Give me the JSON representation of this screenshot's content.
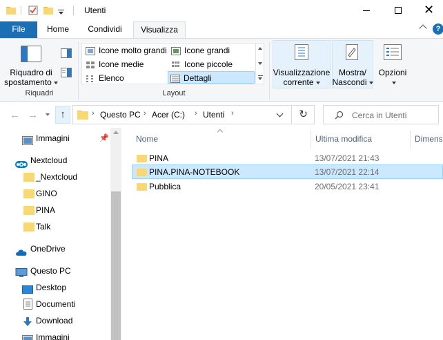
{
  "window": {
    "title": "Utenti",
    "minimize_symbol": "",
    "maximize_symbol": "",
    "close_symbol": "✕"
  },
  "ribbon_tabs": [
    {
      "label": "File"
    },
    {
      "label": "Home"
    },
    {
      "label": "Condividi"
    },
    {
      "label": "Visualizza"
    }
  ],
  "ribbon": {
    "panes_group": {
      "nav_pane_line1": "Riquadro di",
      "nav_pane_line2": "spostamento",
      "label": "Riquadri"
    },
    "layout_group": {
      "items": [
        {
          "label": "Icone molto grandi"
        },
        {
          "label": "Icone grandi"
        },
        {
          "label": "Icone medie"
        },
        {
          "label": "Icone piccole"
        },
        {
          "label": "Elenco"
        },
        {
          "label": "Dettagli"
        }
      ],
      "selected": "Dettagli",
      "label": "Layout"
    },
    "current_view": {
      "line1": "Visualizzazione",
      "line2": "corrente"
    },
    "show_hide": {
      "line1": "Mostra/",
      "line2": "Nascondi"
    },
    "options": {
      "label": "Opzioni"
    }
  },
  "address_bar": {
    "breadcrumbs": [
      "Questo PC",
      "Acer (C:)",
      "Utenti"
    ],
    "search_placeholder": "Cerca in Utenti"
  },
  "nav_pane": {
    "items": [
      {
        "label": "Immagini",
        "icon": "pictures-icon"
      },
      {
        "label": "Nextcloud",
        "icon": "nextcloud-icon"
      },
      {
        "label": "_Nextcloud",
        "icon": "folder-icon"
      },
      {
        "label": "GINO",
        "icon": "folder-icon"
      },
      {
        "label": "PINA",
        "icon": "folder-icon"
      },
      {
        "label": "Talk",
        "icon": "folder-icon"
      },
      {
        "label": "OneDrive",
        "icon": "onedrive-icon"
      },
      {
        "label": "Questo PC",
        "icon": "computer-icon"
      },
      {
        "label": "Desktop",
        "icon": "desktop-icon"
      },
      {
        "label": "Documenti",
        "icon": "documents-icon"
      },
      {
        "label": "Download",
        "icon": "download-icon"
      },
      {
        "label": "Immagini",
        "icon": "pictures-icon"
      }
    ]
  },
  "file_list": {
    "columns": [
      "Nome",
      "Ultima modifica",
      "Dimens"
    ],
    "rows": [
      {
        "name": "PINA",
        "modified": "13/07/2021 21:43"
      },
      {
        "name": "PINA.PINA-NOTEBOOK",
        "modified": "13/07/2021 22:14"
      },
      {
        "name": "Pubblica",
        "modified": "20/05/2021 23:41"
      }
    ],
    "selected_row": "PINA.PINA-NOTEBOOK"
  },
  "colors": {
    "file_tab": "#1a6fb5",
    "selection": "#cce8ff",
    "selection_border": "#99d1ff",
    "folder": "#f8d775"
  }
}
